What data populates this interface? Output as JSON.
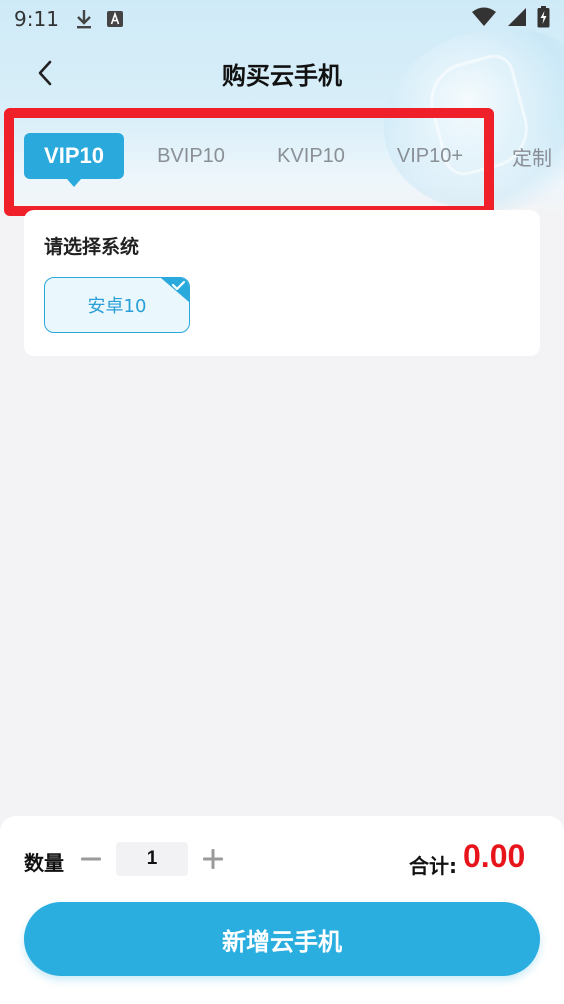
{
  "status_bar": {
    "time": "9:11",
    "icons": [
      "download-icon",
      "a-keyboard-icon",
      "wifi-icon",
      "signal-icon",
      "battery-charging-icon"
    ]
  },
  "nav": {
    "title": "购买云手机",
    "back_icon": "chevron-left-icon"
  },
  "tabs": [
    {
      "label": "VIP10",
      "active": true
    },
    {
      "label": "BVIP10",
      "active": false
    },
    {
      "label": "KVIP10",
      "active": false
    },
    {
      "label": "VIP10+",
      "active": false
    },
    {
      "label": "定制",
      "active": false
    }
  ],
  "system_card": {
    "title": "请选择系统",
    "options": [
      {
        "label": "安卓10",
        "selected": true
      }
    ]
  },
  "bottom": {
    "quantity_label": "数量",
    "quantity_value": "1",
    "total_label": "合计:",
    "total_value": "0.00",
    "submit_label": "新增云手机"
  },
  "colors": {
    "accent": "#2aa9dd",
    "price": "#e8141c",
    "highlight": "#f0202b"
  }
}
